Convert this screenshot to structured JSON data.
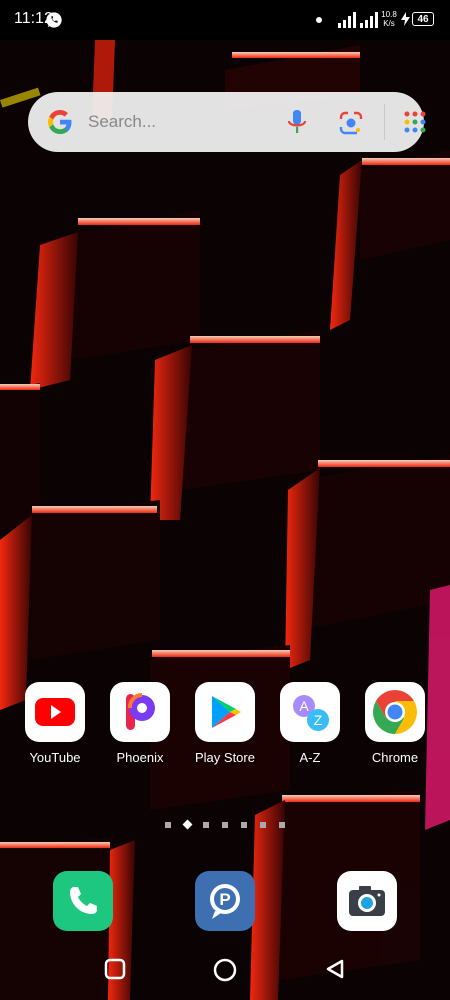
{
  "status_bar": {
    "time": "11:12",
    "network_speed_value": "10.8",
    "network_speed_unit": "K/s",
    "battery_level": "46"
  },
  "search_bar": {
    "placeholder": "Search..."
  },
  "apps": [
    {
      "label": "YouTube",
      "icon": "youtube-icon"
    },
    {
      "label": "Phoenix",
      "icon": "phoenix-browser-icon"
    },
    {
      "label": "Play Store",
      "icon": "play-store-icon"
    },
    {
      "label": "A-Z",
      "icon": "a-z-translate-icon"
    },
    {
      "label": "Chrome",
      "icon": "chrome-icon"
    }
  ],
  "dock": [
    {
      "icon": "phone-icon",
      "color": "#1ec780"
    },
    {
      "icon": "pinterest-like-chat-icon",
      "color": "#3d6fb1"
    },
    {
      "icon": "camera-icon",
      "color": "#ffffff"
    }
  ],
  "page_indicator": {
    "pages": 7,
    "current": 2
  },
  "colors": {
    "accent_red": "#ff2a1a",
    "status_bar_bg": "#000000"
  }
}
